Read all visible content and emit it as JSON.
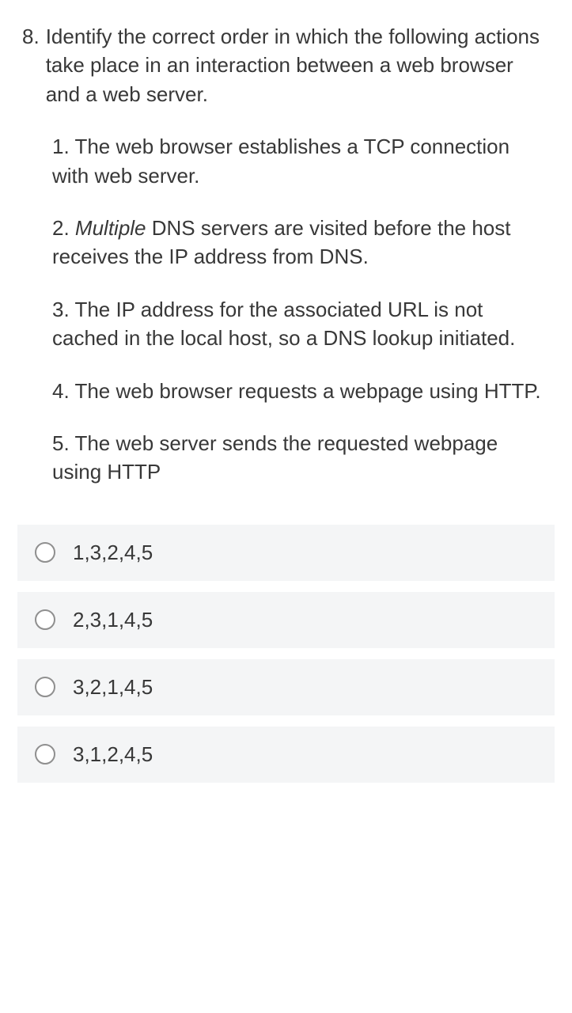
{
  "question": {
    "number": "8.",
    "stem": "Identify the correct order in which the following actions take place in an interaction between a web browser and a web server.",
    "items": [
      {
        "lead": "1. The web browser establishes a TCP connection with web server."
      },
      {
        "lead_prefix": "2. ",
        "italic": "Multiple",
        "lead_suffix": "  DNS servers are visited before the host receives the IP address from DNS."
      },
      {
        "lead": "3. The IP address for the associated URL is not cached in the local host, so a DNS lookup initiated."
      },
      {
        "lead": "4. The web browser requests a webpage using HTTP."
      },
      {
        "lead": "5. The web server sends the requested webpage using HTTP"
      }
    ]
  },
  "options": [
    {
      "label": "1,3,2,4,5"
    },
    {
      "label": "2,3,1,4,5"
    },
    {
      "label": "3,2,1,4,5"
    },
    {
      "label": "3,1,2,4,5"
    }
  ]
}
